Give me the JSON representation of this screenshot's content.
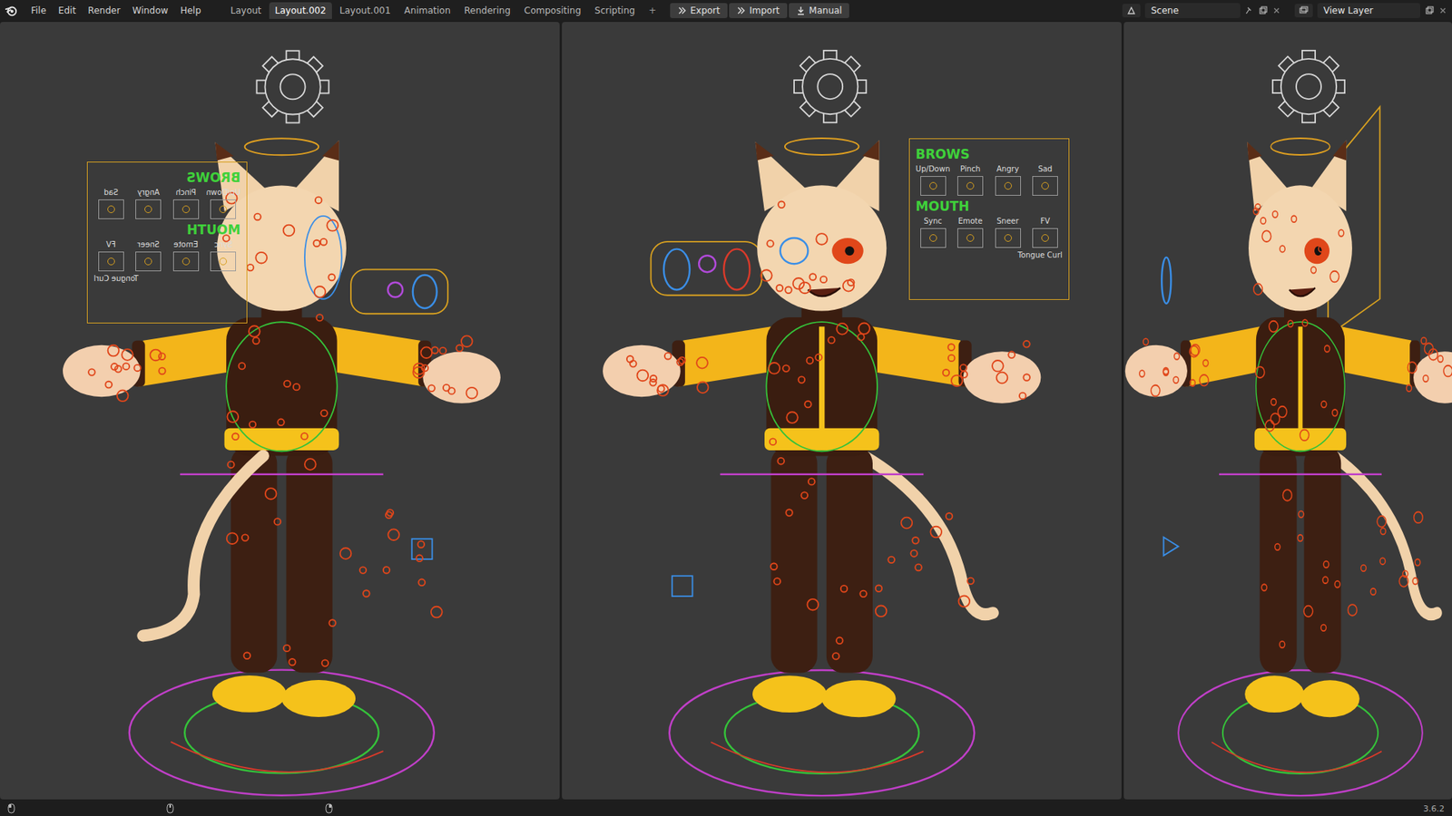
{
  "menu": [
    "File",
    "Edit",
    "Render",
    "Window",
    "Help"
  ],
  "workspaces": [
    {
      "label": "Layout",
      "selected": false
    },
    {
      "label": "Layout.002",
      "selected": true
    },
    {
      "label": "Layout.001",
      "selected": false
    },
    {
      "label": "Animation",
      "selected": false
    },
    {
      "label": "Rendering",
      "selected": false
    },
    {
      "label": "Compositing",
      "selected": false
    },
    {
      "label": "Scripting",
      "selected": false
    }
  ],
  "add_workspace": "+",
  "addon_buttons": [
    "Export",
    "Import",
    "Manual"
  ],
  "scene": {
    "name": "Scene"
  },
  "view_layer": {
    "name": "View Layer"
  },
  "viewports": [
    {
      "view": "back",
      "panel": true
    },
    {
      "view": "front",
      "panel": true
    },
    {
      "view": "side",
      "panel": false
    }
  ],
  "face_panel": {
    "sections": [
      {
        "title": "BROWS",
        "controls": [
          "Up/Down",
          "Pinch",
          "Angry",
          "Sad"
        ]
      },
      {
        "title": "MOUTH",
        "controls": [
          "Sync",
          "Emote",
          "Sneer",
          "FV"
        ]
      }
    ],
    "extra": "Tongue Curl"
  },
  "status_bar": {
    "version": "3.6.2"
  }
}
